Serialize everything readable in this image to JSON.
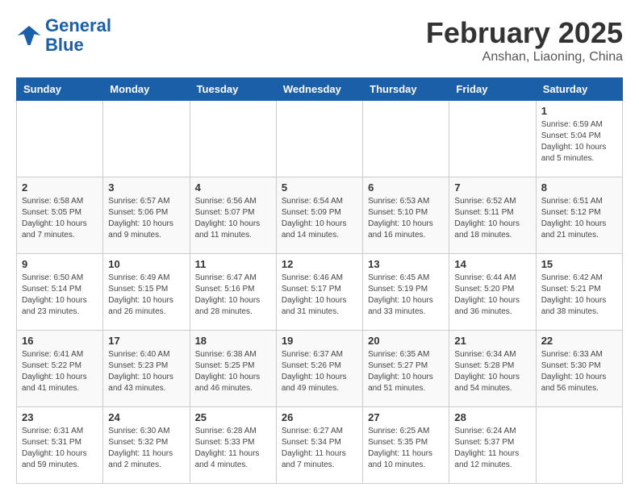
{
  "logo": {
    "general": "General",
    "blue": "Blue"
  },
  "header": {
    "title": "February 2025",
    "subtitle": "Anshan, Liaoning, China"
  },
  "weekdays": [
    "Sunday",
    "Monday",
    "Tuesday",
    "Wednesday",
    "Thursday",
    "Friday",
    "Saturday"
  ],
  "weeks": [
    [
      {
        "day": "",
        "info": ""
      },
      {
        "day": "",
        "info": ""
      },
      {
        "day": "",
        "info": ""
      },
      {
        "day": "",
        "info": ""
      },
      {
        "day": "",
        "info": ""
      },
      {
        "day": "",
        "info": ""
      },
      {
        "day": "1",
        "info": "Sunrise: 6:59 AM\nSunset: 5:04 PM\nDaylight: 10 hours and 5 minutes."
      }
    ],
    [
      {
        "day": "2",
        "info": "Sunrise: 6:58 AM\nSunset: 5:05 PM\nDaylight: 10 hours and 7 minutes."
      },
      {
        "day": "3",
        "info": "Sunrise: 6:57 AM\nSunset: 5:06 PM\nDaylight: 10 hours and 9 minutes."
      },
      {
        "day": "4",
        "info": "Sunrise: 6:56 AM\nSunset: 5:07 PM\nDaylight: 10 hours and 11 minutes."
      },
      {
        "day": "5",
        "info": "Sunrise: 6:54 AM\nSunset: 5:09 PM\nDaylight: 10 hours and 14 minutes."
      },
      {
        "day": "6",
        "info": "Sunrise: 6:53 AM\nSunset: 5:10 PM\nDaylight: 10 hours and 16 minutes."
      },
      {
        "day": "7",
        "info": "Sunrise: 6:52 AM\nSunset: 5:11 PM\nDaylight: 10 hours and 18 minutes."
      },
      {
        "day": "8",
        "info": "Sunrise: 6:51 AM\nSunset: 5:12 PM\nDaylight: 10 hours and 21 minutes."
      }
    ],
    [
      {
        "day": "9",
        "info": "Sunrise: 6:50 AM\nSunset: 5:14 PM\nDaylight: 10 hours and 23 minutes."
      },
      {
        "day": "10",
        "info": "Sunrise: 6:49 AM\nSunset: 5:15 PM\nDaylight: 10 hours and 26 minutes."
      },
      {
        "day": "11",
        "info": "Sunrise: 6:47 AM\nSunset: 5:16 PM\nDaylight: 10 hours and 28 minutes."
      },
      {
        "day": "12",
        "info": "Sunrise: 6:46 AM\nSunset: 5:17 PM\nDaylight: 10 hours and 31 minutes."
      },
      {
        "day": "13",
        "info": "Sunrise: 6:45 AM\nSunset: 5:19 PM\nDaylight: 10 hours and 33 minutes."
      },
      {
        "day": "14",
        "info": "Sunrise: 6:44 AM\nSunset: 5:20 PM\nDaylight: 10 hours and 36 minutes."
      },
      {
        "day": "15",
        "info": "Sunrise: 6:42 AM\nSunset: 5:21 PM\nDaylight: 10 hours and 38 minutes."
      }
    ],
    [
      {
        "day": "16",
        "info": "Sunrise: 6:41 AM\nSunset: 5:22 PM\nDaylight: 10 hours and 41 minutes."
      },
      {
        "day": "17",
        "info": "Sunrise: 6:40 AM\nSunset: 5:23 PM\nDaylight: 10 hours and 43 minutes."
      },
      {
        "day": "18",
        "info": "Sunrise: 6:38 AM\nSunset: 5:25 PM\nDaylight: 10 hours and 46 minutes."
      },
      {
        "day": "19",
        "info": "Sunrise: 6:37 AM\nSunset: 5:26 PM\nDaylight: 10 hours and 49 minutes."
      },
      {
        "day": "20",
        "info": "Sunrise: 6:35 AM\nSunset: 5:27 PM\nDaylight: 10 hours and 51 minutes."
      },
      {
        "day": "21",
        "info": "Sunrise: 6:34 AM\nSunset: 5:28 PM\nDaylight: 10 hours and 54 minutes."
      },
      {
        "day": "22",
        "info": "Sunrise: 6:33 AM\nSunset: 5:30 PM\nDaylight: 10 hours and 56 minutes."
      }
    ],
    [
      {
        "day": "23",
        "info": "Sunrise: 6:31 AM\nSunset: 5:31 PM\nDaylight: 10 hours and 59 minutes."
      },
      {
        "day": "24",
        "info": "Sunrise: 6:30 AM\nSunset: 5:32 PM\nDaylight: 11 hours and 2 minutes."
      },
      {
        "day": "25",
        "info": "Sunrise: 6:28 AM\nSunset: 5:33 PM\nDaylight: 11 hours and 4 minutes."
      },
      {
        "day": "26",
        "info": "Sunrise: 6:27 AM\nSunset: 5:34 PM\nDaylight: 11 hours and 7 minutes."
      },
      {
        "day": "27",
        "info": "Sunrise: 6:25 AM\nSunset: 5:35 PM\nDaylight: 11 hours and 10 minutes."
      },
      {
        "day": "28",
        "info": "Sunrise: 6:24 AM\nSunset: 5:37 PM\nDaylight: 11 hours and 12 minutes."
      },
      {
        "day": "",
        "info": ""
      }
    ]
  ]
}
